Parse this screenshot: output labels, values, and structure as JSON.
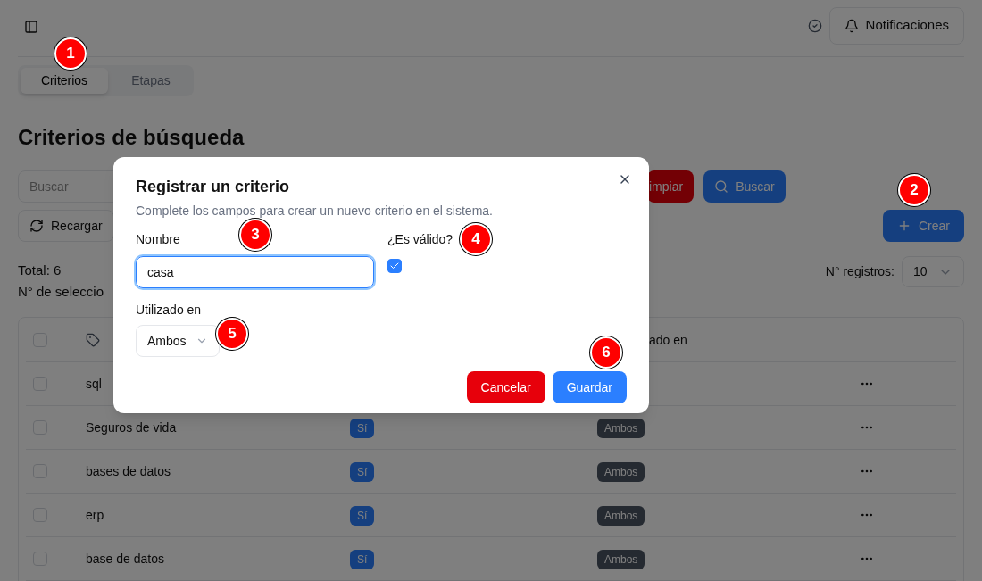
{
  "header": {
    "notifications": "Notificaciones"
  },
  "tabs": [
    {
      "label": "Criterios",
      "selected": true
    },
    {
      "label": "Etapas",
      "selected": false
    }
  ],
  "page_title": "Criterios de búsqueda",
  "search": {
    "placeholder": "Buscar"
  },
  "buttons": {
    "clear": "impiar",
    "search": "Buscar",
    "reload": "Recargar",
    "create": "Crear"
  },
  "total": "Total: 6",
  "selected_count": "N° de seleccio",
  "page_size": {
    "label": "N° registros:",
    "value": "10"
  },
  "table": {
    "header_checked": false,
    "columns": [
      "ado en"
    ],
    "rows": [
      {
        "name": "sql",
        "checked": false
      },
      {
        "name": "Seguros de vida",
        "valid": "Sí",
        "used_in": "Ambos",
        "checked": false
      },
      {
        "name": "bases de datos",
        "valid": "Sí",
        "used_in": "Ambos",
        "checked": false
      },
      {
        "name": "erp",
        "valid": "Sí",
        "used_in": "Ambos",
        "checked": false
      },
      {
        "name": "base de datos",
        "valid": "Sí",
        "used_in": "Ambos",
        "checked": false
      }
    ]
  },
  "dialog": {
    "title": "Registrar un criterio",
    "description": "Complete los campos para crear un nuevo criterio en el sistema.",
    "name_label": "Nombre",
    "name_value": "casa",
    "valid_label": "¿Es válido?",
    "valid_checked": true,
    "used_label": "Utilizado en",
    "used_value": "Ambos",
    "cancel": "Cancelar",
    "save": "Guardar"
  },
  "annotations": [
    "1",
    "2",
    "3",
    "4",
    "5",
    "6"
  ]
}
